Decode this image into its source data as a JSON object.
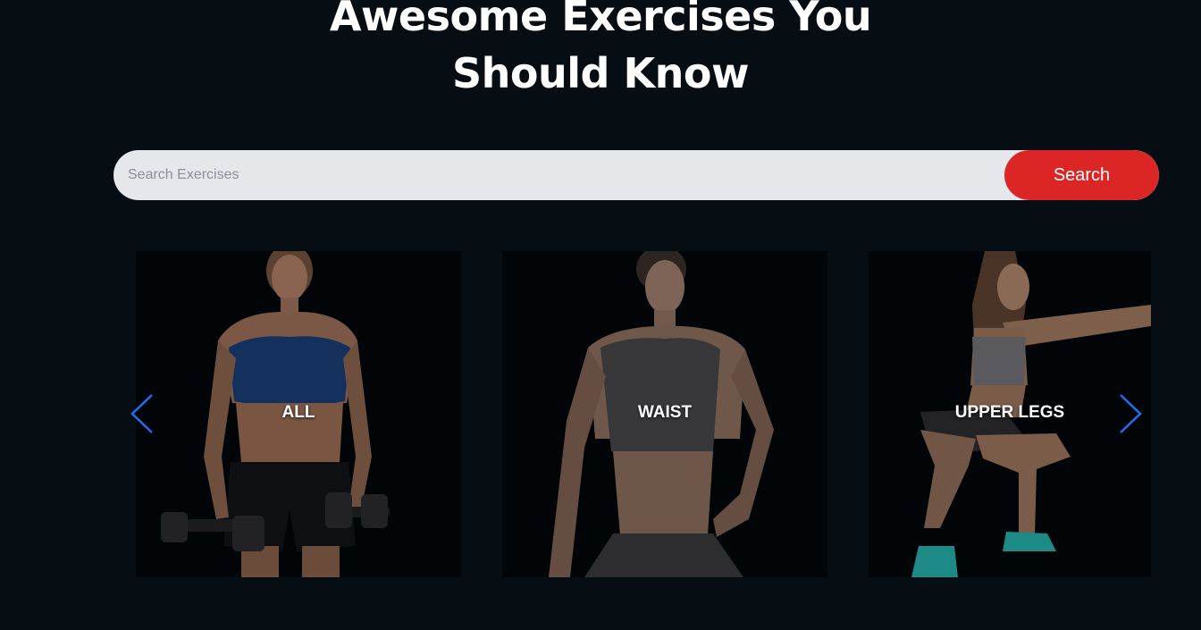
{
  "hero": {
    "title_line1": "Awesome Exercises You",
    "title_line2": "Should Know"
  },
  "search": {
    "placeholder": "Search Exercises",
    "value": "",
    "button_label": "Search"
  },
  "carousel": {
    "prev_icon": "chevron-left-icon",
    "next_icon": "chevron-right-icon",
    "cards": [
      {
        "label": "ALL"
      },
      {
        "label": "WAIST"
      },
      {
        "label": "UPPER LEGS"
      }
    ]
  },
  "colors": {
    "background": "#060d13",
    "search_bar": "#e6e7eb",
    "search_button": "#dc2626",
    "arrow": "#1d6ff2"
  }
}
